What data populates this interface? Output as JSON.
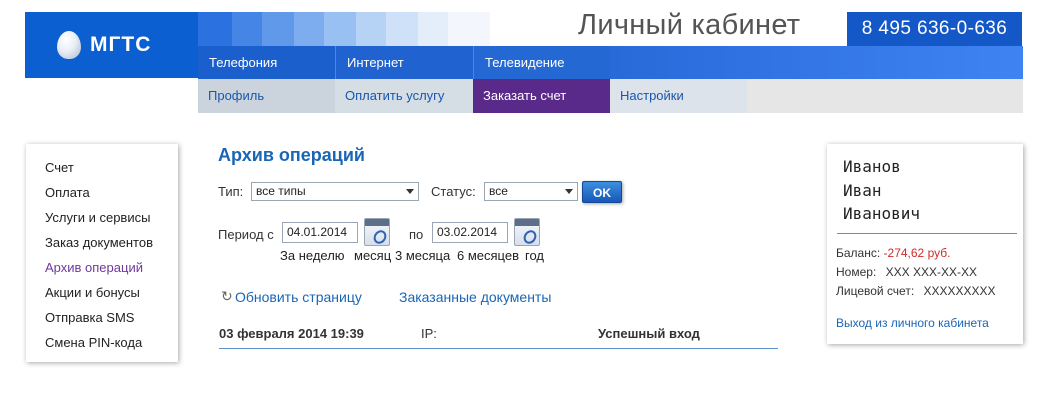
{
  "header": {
    "logo_text": "МГТС",
    "title": "Личный кабинет",
    "phone": "8 495 636-0-636",
    "brand_color": "#0b5fd0"
  },
  "nav": {
    "top": [
      "Телефония",
      "Интернет",
      "Телевидение"
    ],
    "bottom": [
      "Профиль",
      "Оплатить услугу",
      "Заказать счет",
      "Настройки"
    ],
    "active_bottom": "Заказать счет",
    "active_color": "#5a2a8a"
  },
  "sidebar": {
    "items": [
      "Счет",
      "Оплата",
      "Услуги и сервисы",
      "Заказ документов",
      "Архив операций",
      "Акции и бонусы",
      "Отправка SMS",
      "Смена PIN-кода"
    ],
    "active": "Архив операций"
  },
  "main": {
    "title": "Архив операций",
    "type_label": "Тип:",
    "type_value": "все типы",
    "status_label": "Статус:",
    "status_value": "все",
    "ok_label": "OK",
    "period_label": "Период с",
    "date_from": "04.01.2014",
    "to_label": "по",
    "date_to": "03.02.2014",
    "quick_periods": [
      "За неделю",
      "месяц",
      "3 месяца",
      "6 месяцев",
      "год"
    ],
    "refresh_label": "Обновить страницу",
    "ordered_docs_label": "Заказанные документы",
    "row": {
      "date": "03 февраля 2014 19:39",
      "ip_label": "IP:",
      "status": "Успешный вход"
    }
  },
  "user": {
    "last_name": "Иванов",
    "first_name": "Иван",
    "patronymic": "Иванович",
    "balance_label": "Баланс:",
    "balance_value": "-274,62 руб.",
    "number_label": "Номер:",
    "number_value": "XXX XXX-XX-XX",
    "account_label": "Лицевой счет:",
    "account_value": "XXXXXXXXX",
    "logout_label": "Выход из личного кабинета"
  }
}
